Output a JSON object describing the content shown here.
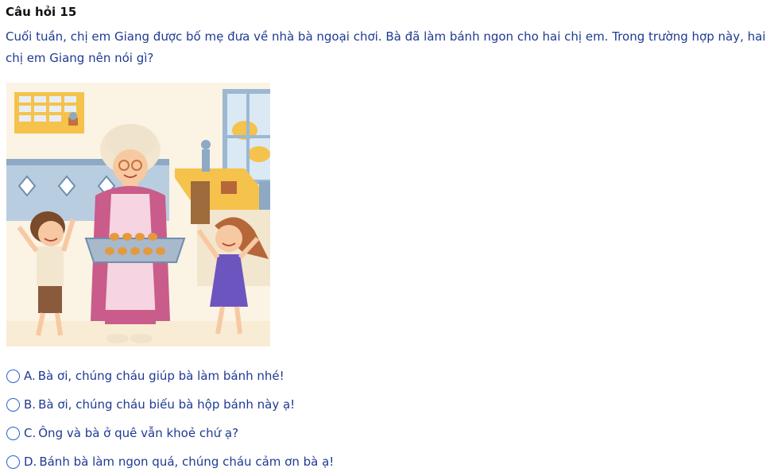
{
  "question": {
    "title": "Câu hỏi 15",
    "text": "Cuối tuần, chị em Giang được bố mẹ đưa về nhà bà ngoại chơi. Bà đã làm bánh ngon cho hai chị em. Trong trường hợp này, hai chị em Giang nên nói gì?"
  },
  "illustration": {
    "icon": "grandmother-baking-with-children-illustration"
  },
  "answers": [
    {
      "letter": "A.",
      "text": "Bà ơi, chúng cháu giúp bà làm bánh nhé!"
    },
    {
      "letter": "B.",
      "text": "Bà ơi, chúng cháu biếu bà hộp bánh này ạ!"
    },
    {
      "letter": "C.",
      "text": "Ông và bà ở quê vẫn khoẻ chứ ạ?"
    },
    {
      "letter": "D.",
      "text": "Bánh bà làm ngon quá, chúng cháu cảm ơn bà ạ!"
    }
  ],
  "colors": {
    "text": "#1f3a93",
    "radio_border": "#2b5fd6"
  }
}
